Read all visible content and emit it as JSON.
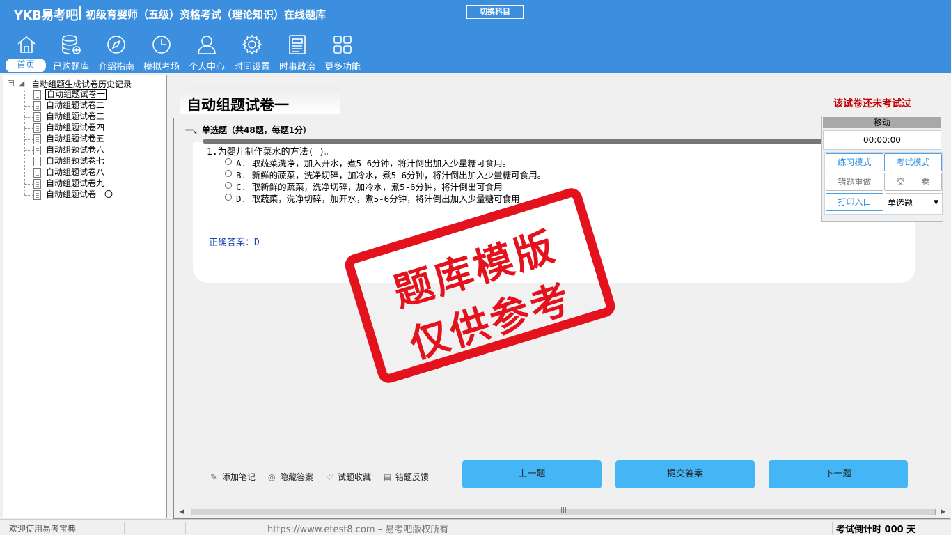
{
  "header": {
    "brand": "YKB易考吧",
    "title": "初级育婴师（五级）资格考试（理论知识）在线题库",
    "switch_subject": "切换科目"
  },
  "nav": [
    {
      "label": "首页",
      "icon": "home-icon"
    },
    {
      "label": "已购题库",
      "icon": "database-icon"
    },
    {
      "label": "介绍指南",
      "icon": "compass-icon"
    },
    {
      "label": "模拟考场",
      "icon": "clock-icon"
    },
    {
      "label": "个人中心",
      "icon": "user-icon"
    },
    {
      "label": "时间设置",
      "icon": "gear-icon"
    },
    {
      "label": "时事政治",
      "icon": "news-icon"
    },
    {
      "label": "更多功能",
      "icon": "grid-icon"
    }
  ],
  "tree": {
    "root": "自动组题生成试卷历史记录",
    "items": [
      "自动组题试卷一",
      "自动组题试卷二",
      "自动组题试卷三",
      "自动组题试卷四",
      "自动组题试卷五",
      "自动组题试卷六",
      "自动组题试卷七",
      "自动组题试卷八",
      "自动组题试卷九",
      "自动组题试卷一〇"
    ]
  },
  "main": {
    "paper_title": "自动组题试卷一",
    "exam_status": "该试卷还未考试过",
    "section_heading": "一、单选题（共48题，每题1分）",
    "question": "1.为婴儿制作菜水的方法(  )。",
    "options": [
      "A. 取蔬菜洗净，加入开水，煮5-6分钟，将汁倒出加入少量糖可食用。",
      "B. 新鲜的蔬菜，洗净切碎，加冷水，煮5-6分钟，将汁倒出加入少量糖可食用。",
      "C. 取新鲜的蔬菜，洗净切碎，加冷水，煮5-6分钟，将汁倒出可食用",
      "D. 取蔬菜，洗净切碎，加开水，煮5-6分钟，将汁倒出加入少量糖可食用"
    ],
    "correct_answer": "正确答案：D",
    "tools": [
      "添加笔记",
      "隐藏答案",
      "试题收藏",
      "错题反馈"
    ],
    "prev_button": "上一题",
    "submit_button": "提交答案",
    "next_button": "下一题"
  },
  "timer_panel": {
    "move_label": "移动",
    "time": "00:00:00",
    "practice_mode": "练习模式",
    "exam_mode": "考试模式",
    "redo_wrong": "错题重做",
    "submit_paper": "交　　卷",
    "print": "打印入口",
    "question_type": "单选题"
  },
  "stamp": {
    "line1": "题库模版",
    "line2": "仅供参考",
    "color": "#e3121c"
  },
  "status_bar": {
    "welcome": "欢迎使用易考宝典",
    "copyright": "https://www.etest8.com – 易考吧版权所有",
    "countdown": "考试倒计时 000 天"
  },
  "colors": {
    "header_blue": "#3b8fde",
    "button_blue": "#45b6f5",
    "status_red": "#c00000"
  }
}
